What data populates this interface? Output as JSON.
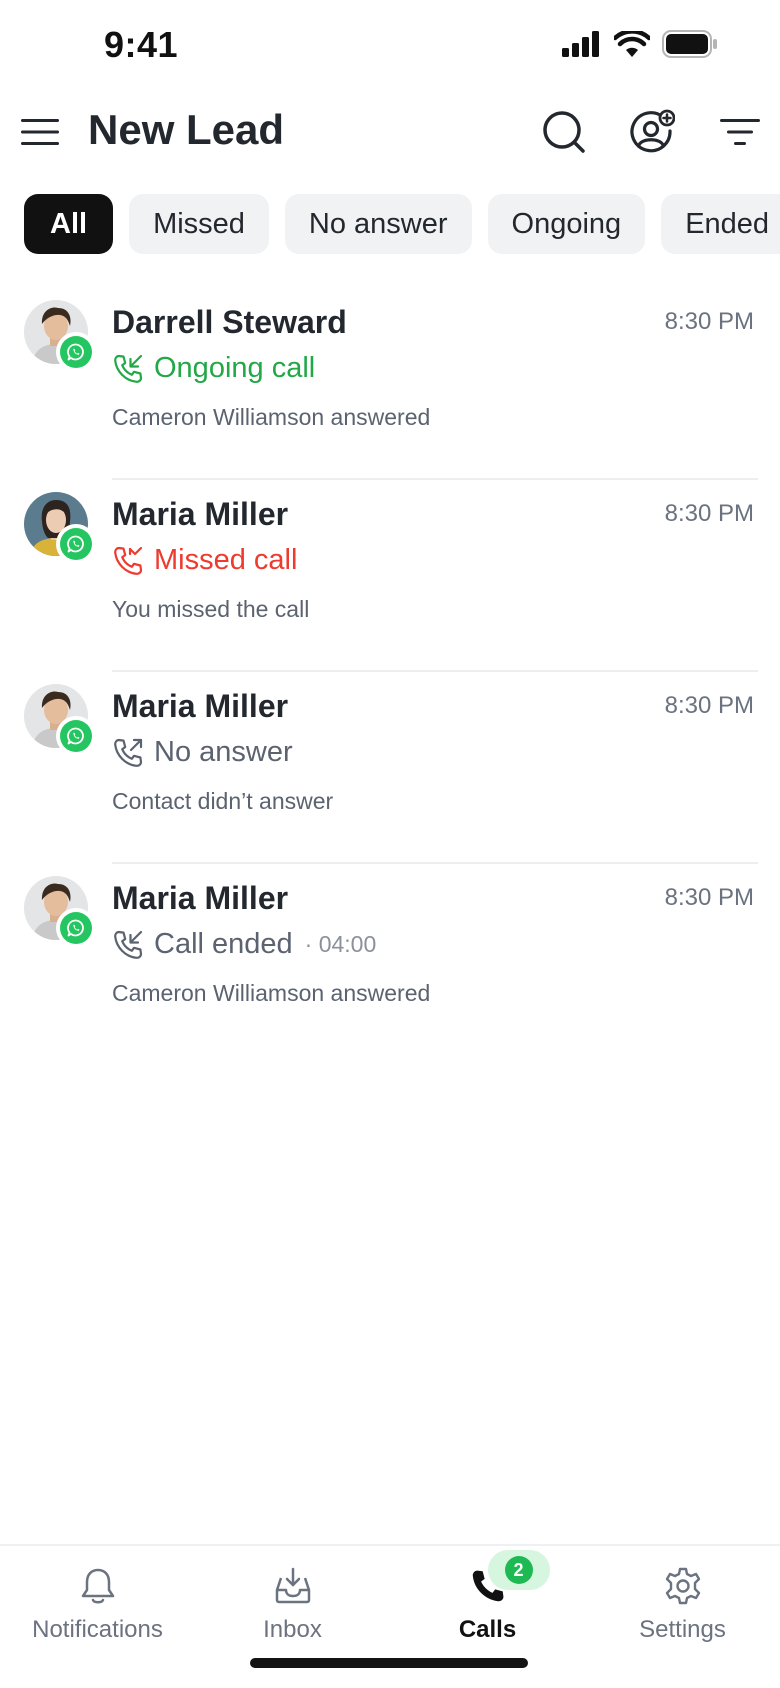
{
  "status_bar": {
    "time": "9:41"
  },
  "header": {
    "title": "New Lead"
  },
  "filters": [
    {
      "label": "All",
      "active": true
    },
    {
      "label": "Missed",
      "active": false
    },
    {
      "label": "No answer",
      "active": false
    },
    {
      "label": "Ongoing",
      "active": false
    },
    {
      "label": "Ended",
      "active": false
    }
  ],
  "calls": [
    {
      "name": "Darrell Steward",
      "time": "8:30 PM",
      "status": "Ongoing call",
      "status_kind": "ongoing",
      "duration": "",
      "sub": "Cameron Williamson answered",
      "avatar": "male"
    },
    {
      "name": "Maria Miller",
      "time": "8:30 PM",
      "status": "Missed call",
      "status_kind": "missed",
      "duration": "",
      "sub": "You missed the call",
      "avatar": "female"
    },
    {
      "name": "Maria Miller",
      "time": "8:30 PM",
      "status": "No answer",
      "status_kind": "no-answer",
      "duration": "",
      "sub": "Contact didn’t answer",
      "avatar": "male"
    },
    {
      "name": "Maria Miller",
      "time": "8:30 PM",
      "status": "Call ended",
      "status_kind": "ended",
      "duration": "· 04:00",
      "sub": "Cameron Williamson answered",
      "avatar": "male"
    }
  ],
  "nav": {
    "notifications": "Notifications",
    "inbox": "Inbox",
    "calls": "Calls",
    "calls_badge": "2",
    "settings": "Settings"
  },
  "colors": {
    "accent_green": "#23a847",
    "missed_red": "#ee3a2f",
    "whatsapp": "#25c661"
  }
}
